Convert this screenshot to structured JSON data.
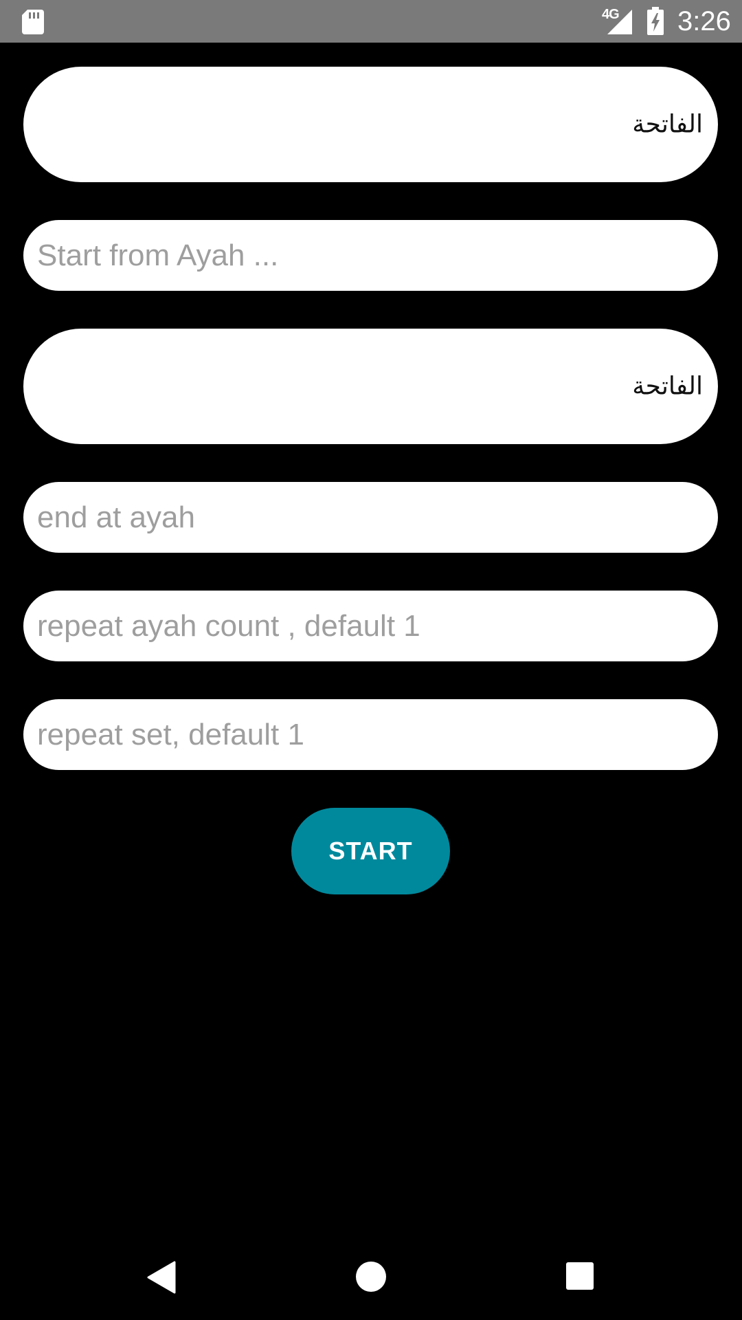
{
  "status_bar": {
    "network_type": "4G",
    "time": "3:26",
    "icons": [
      "sd-card-icon",
      "signal-icon",
      "battery-charging-icon"
    ]
  },
  "form": {
    "surah_start": {
      "value": "الفاتحة"
    },
    "start_ayah": {
      "placeholder": "Start from Ayah ..."
    },
    "surah_end": {
      "value": "الفاتحة"
    },
    "end_ayah": {
      "placeholder": "end at ayah"
    },
    "repeat_ayah": {
      "placeholder": "repeat ayah count , default 1"
    },
    "repeat_set": {
      "placeholder": "repeat set, default 1"
    },
    "start_button": "START"
  },
  "nav_bar": {
    "icons": [
      "back-icon",
      "home-icon",
      "recent-apps-icon"
    ]
  },
  "colors": {
    "background": "#000000",
    "status_bar": "#7a7a7a",
    "field_background": "#ffffff",
    "placeholder": "#9e9e9e",
    "accent": "#00899d"
  }
}
